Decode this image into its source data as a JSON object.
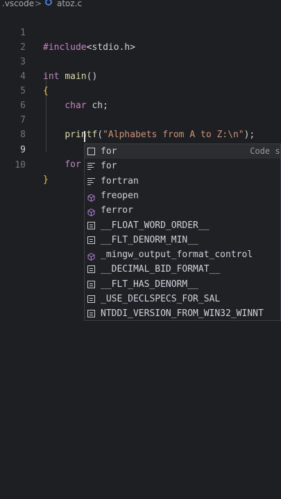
{
  "breadcrumb": {
    "folder": ".vscode",
    "separator": ">",
    "file": "atoz.c"
  },
  "editor": {
    "lines": [
      {
        "num": "1",
        "text": "#include<stdio.h>"
      },
      {
        "num": "2",
        "text": ""
      },
      {
        "num": "3",
        "text": "int main()"
      },
      {
        "num": "4",
        "text": "{"
      },
      {
        "num": "5",
        "text": "    char ch;"
      },
      {
        "num": "6",
        "text": ""
      },
      {
        "num": "7",
        "text": "    printf(\"Alphabets from A to Z:\\n\");"
      },
      {
        "num": "8",
        "text": ""
      },
      {
        "num": "9",
        "text": "    for"
      },
      {
        "num": "10",
        "text": "}"
      }
    ]
  },
  "suggestions": {
    "detail": "Code sni",
    "items": [
      {
        "icon": "snippet-icon",
        "label": "for",
        "selected": true
      },
      {
        "icon": "keyword-icon",
        "label": "for"
      },
      {
        "icon": "keyword-icon",
        "label": "fortran"
      },
      {
        "icon": "method-icon",
        "label": "freopen"
      },
      {
        "icon": "method-icon",
        "label": "ferror"
      },
      {
        "icon": "field-icon",
        "label": "__FLOAT_WORD_ORDER__"
      },
      {
        "icon": "field-icon",
        "label": "__FLT_DENORM_MIN__"
      },
      {
        "icon": "method-icon",
        "label": "_mingw_output_format_control"
      },
      {
        "icon": "field-icon",
        "label": "__DECIMAL_BID_FORMAT__"
      },
      {
        "icon": "field-icon",
        "label": "__FLT_HAS_DENORM__"
      },
      {
        "icon": "field-icon",
        "label": "_USE_DECLSPECS_FOR_SAL"
      },
      {
        "icon": "field-icon",
        "label": "NTDDI_VERSION_FROM_WIN32_WINNT"
      }
    ]
  }
}
